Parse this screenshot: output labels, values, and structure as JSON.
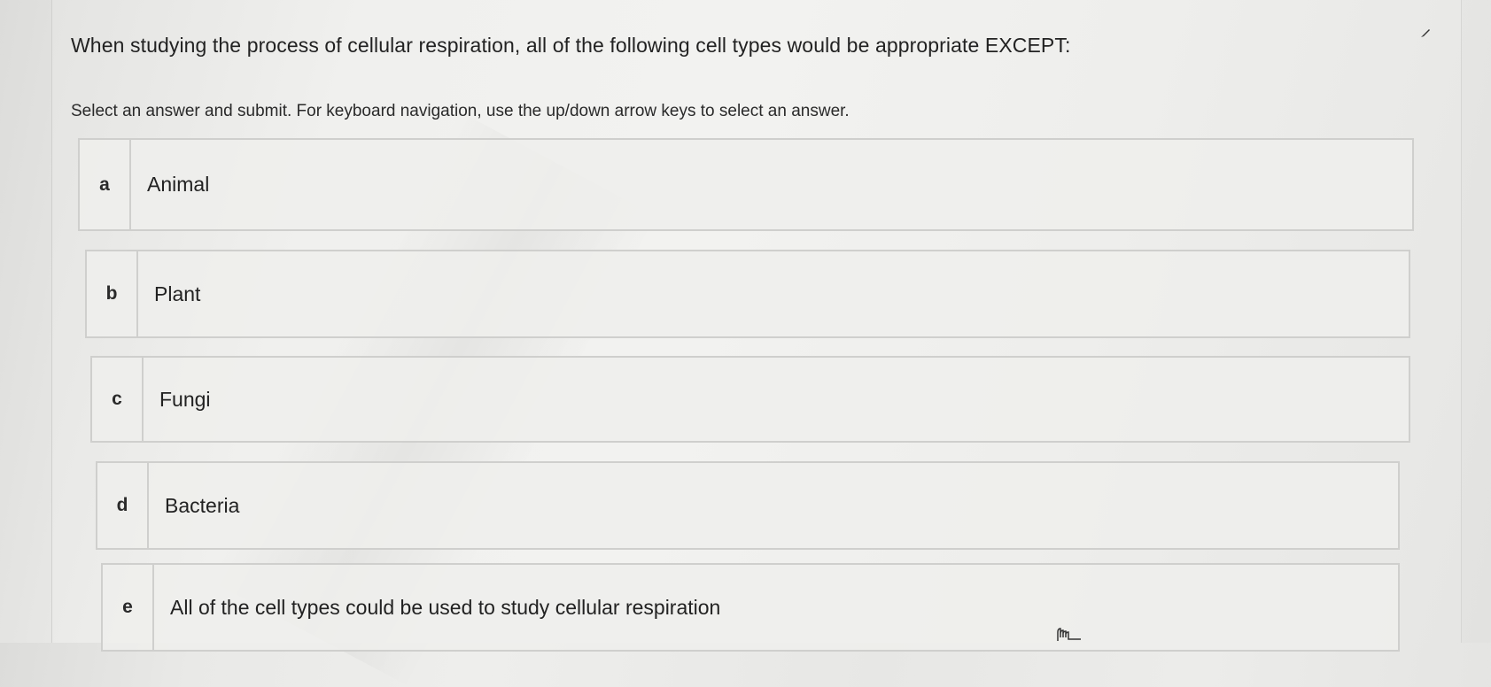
{
  "question": {
    "text": "When studying the process of cellular respiration, all of the following cell types would be appropriate EXCEPT:"
  },
  "instructions": {
    "text": "Select an answer and submit. For keyboard navigation, use the up/down arrow keys to select an answer."
  },
  "options": [
    {
      "letter": "a",
      "label": "Animal"
    },
    {
      "letter": "b",
      "label": "Plant"
    },
    {
      "letter": "c",
      "label": "Fungi"
    },
    {
      "letter": "d",
      "label": "Bacteria"
    },
    {
      "letter": "e",
      "label": "All of the cell types could be used to study cellular respiration"
    }
  ],
  "icons": {
    "top_right": "pencil-icon",
    "pointer": "hand-cursor-icon"
  }
}
